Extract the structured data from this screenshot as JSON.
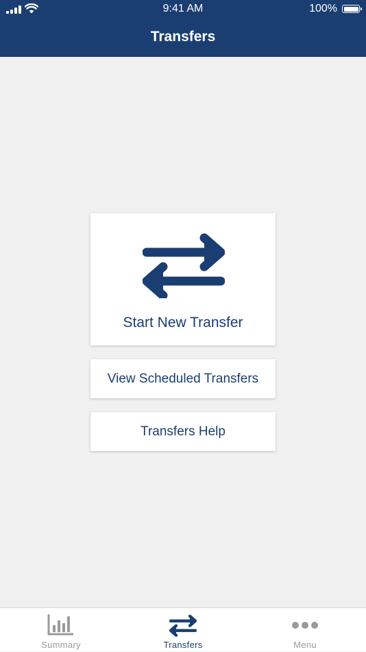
{
  "status_bar": {
    "time": "9:41 AM",
    "battery_percent": "100%",
    "icons": [
      "signal-icon",
      "wifi-icon",
      "battery-icon"
    ]
  },
  "header": {
    "title": "Transfers"
  },
  "main": {
    "primary_action": {
      "label": "Start New Transfer",
      "icon": "transfer-arrows-icon"
    },
    "actions": [
      {
        "label": "View Scheduled Transfers"
      },
      {
        "label": "Transfers Help"
      }
    ]
  },
  "tab_bar": {
    "tabs": [
      {
        "label": "Summary",
        "icon": "bar-chart-icon",
        "active": false
      },
      {
        "label": "Transfers",
        "icon": "transfer-arrows-icon",
        "active": true
      },
      {
        "label": "Menu",
        "icon": "more-dots-icon",
        "active": false
      }
    ]
  },
  "colors": {
    "brand": "#1a3e72",
    "background": "#f0f0f0",
    "card": "#ffffff",
    "inactive": "#9a9a9a"
  }
}
